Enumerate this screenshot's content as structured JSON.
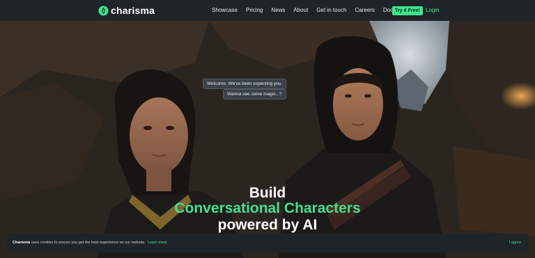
{
  "brand": {
    "name": "charisma"
  },
  "nav": {
    "links": [
      "Showcase",
      "Pricing",
      "News",
      "About",
      "Get in touch",
      "Careers",
      "Docs"
    ],
    "try_label": "Try it Free!",
    "login_label": "Login"
  },
  "hero": {
    "bubble_1": "Welcome. We've been expecting you.",
    "bubble_2": "Wanna see some magic...?",
    "headline_line_1": "Build",
    "headline_line_2": "Conversational Characters",
    "headline_line_3": "powered by AI"
  },
  "cookie": {
    "brand": "Charisma",
    "text": " uses cookies to ensure you get the best experience on our website.",
    "learn_more": "Learn more",
    "agree": "I agree"
  },
  "colors": {
    "accent": "#42e08f",
    "navbar": "#1f2428",
    "text": "#ffffff"
  }
}
